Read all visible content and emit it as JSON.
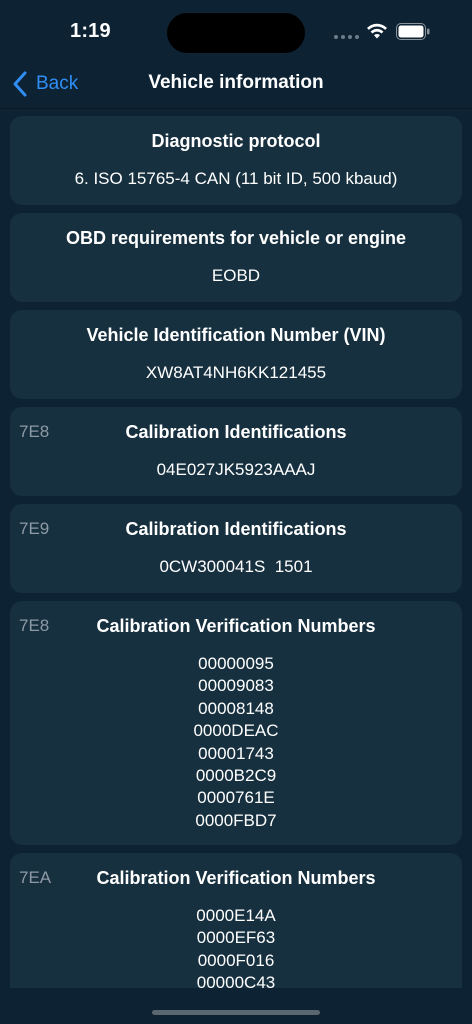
{
  "status_bar": {
    "time": "1:19"
  },
  "nav": {
    "back_label": "Back",
    "title": "Vehicle information"
  },
  "cards": [
    {
      "ecu": "",
      "title": "Diagnostic protocol",
      "value": "6. ISO 15765-4 CAN (11 bit ID, 500 kbaud)"
    },
    {
      "ecu": "",
      "title": "OBD requirements for vehicle or engine",
      "value": "EOBD"
    },
    {
      "ecu": "",
      "title": "Vehicle Identification Number (VIN)",
      "value": "XW8AT4NH6KK121455"
    },
    {
      "ecu": "7E8",
      "title": "Calibration Identifications",
      "value": "04E027JK5923AAAJ"
    },
    {
      "ecu": "7E9",
      "title": "Calibration Identifications",
      "value": "0CW300041S  1501"
    }
  ],
  "list_cards": [
    {
      "ecu": "7E8",
      "title": "Calibration Verification Numbers",
      "values": [
        "00000095",
        "00009083",
        "00008148",
        "0000DEAC",
        "00001743",
        "0000B2C9",
        "0000761E",
        "0000FBD7"
      ]
    },
    {
      "ecu": "7EA",
      "title": "Calibration Verification Numbers",
      "values": [
        "0000E14A",
        "0000EF63",
        "0000F016",
        "00000C43"
      ]
    }
  ]
}
